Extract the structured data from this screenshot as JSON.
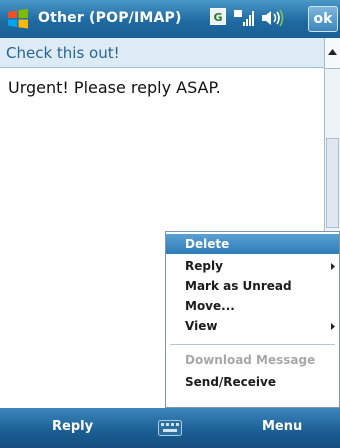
{
  "titlebar": {
    "title": "Other (POP/IMAP)",
    "ok_label": "ok",
    "icons": [
      "windows-start-icon",
      "gprs-icon",
      "signal-icon",
      "volume-icon"
    ]
  },
  "message": {
    "subject": "Check this out!",
    "body": "Urgent! Please reply ASAP."
  },
  "menu": {
    "items": [
      {
        "label": "Delete",
        "selected": true,
        "enabled": true,
        "submenu": false
      },
      {
        "label": "Reply",
        "selected": false,
        "enabled": true,
        "submenu": true
      },
      {
        "label": "Mark as Unread",
        "selected": false,
        "enabled": true,
        "submenu": false
      },
      {
        "label": "Move...",
        "selected": false,
        "enabled": true,
        "submenu": false
      },
      {
        "label": "View",
        "selected": false,
        "enabled": true,
        "submenu": true
      },
      {
        "label": "Download Message",
        "selected": false,
        "enabled": false,
        "submenu": false
      },
      {
        "label": "Send/Receive",
        "selected": false,
        "enabled": true,
        "submenu": false
      }
    ]
  },
  "softkeys": {
    "left": "Reply",
    "right": "Menu"
  },
  "colors": {
    "titlebar": "#1f6aa2",
    "subject_bg": "#dcebf6",
    "subject_text": "#2a6496",
    "menu_highlight": "#2e7db8",
    "disabled_text": "#a8a8a8"
  }
}
